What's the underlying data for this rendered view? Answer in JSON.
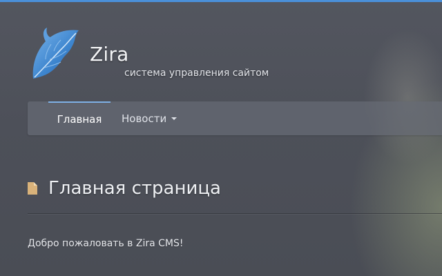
{
  "header": {
    "site_title": "Zira",
    "site_subtitle": "система управления сайтом",
    "logo_icon": "leaf-icon"
  },
  "nav": {
    "items": [
      {
        "label": "Главная",
        "active": true
      },
      {
        "label": "Новости",
        "has_dropdown": true,
        "dropdown_icon": "caret-down-icon"
      }
    ]
  },
  "main": {
    "title_icon": "document-icon",
    "title": "Главная страница",
    "welcome_text": "Добро пожаловать в Zira CMS!"
  },
  "colors": {
    "accent": "#4a90d9",
    "active_nav_border": "#7fb1e6",
    "doc_icon": "#d9b27a",
    "background": "#4c4f58",
    "navbar": "#676b75"
  }
}
